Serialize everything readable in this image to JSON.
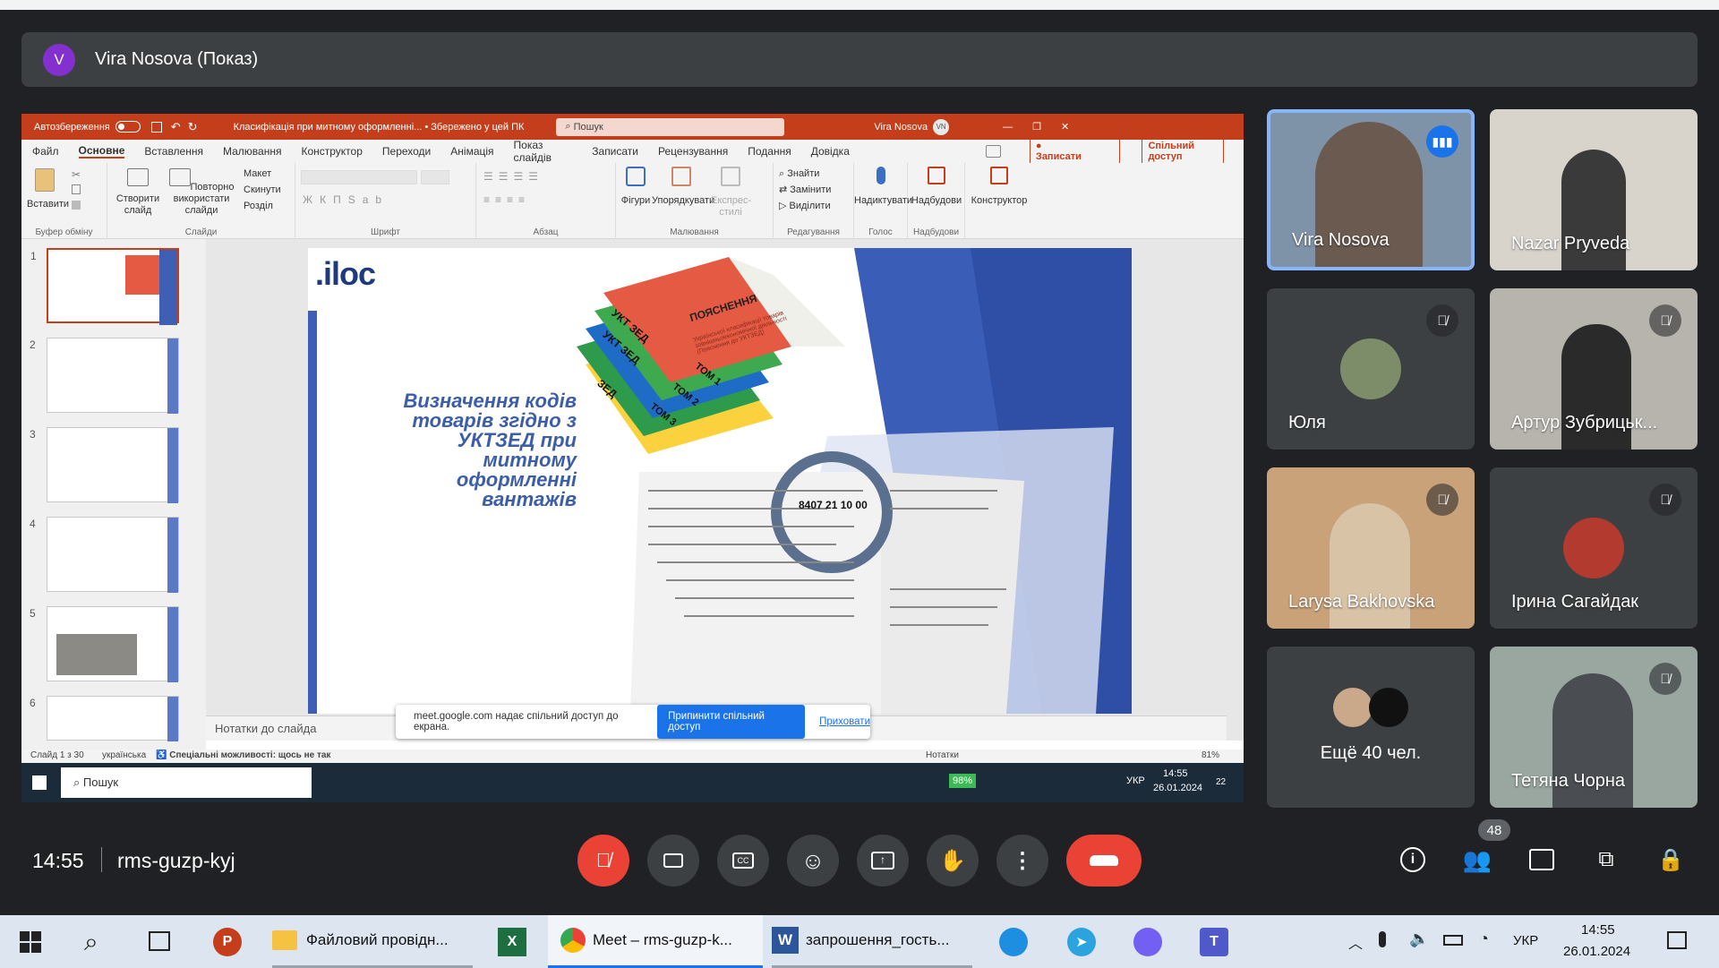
{
  "presenter": {
    "initial": "V",
    "name": "Vira Nosova (Показ)"
  },
  "ppt": {
    "autosave": "Автозбереження",
    "doc_title": "Класифікація при митному оформленні... • Збережено у цей ПК",
    "search_placeholder": "Пошук",
    "user": "Vira Nosova",
    "user_initials": "VN",
    "menu": [
      "Файл",
      "Основне",
      "Вставлення",
      "Малювання",
      "Конструктор",
      "Переходи",
      "Анімація",
      "Показ слайдів",
      "Записати",
      "Рецензування",
      "Подання",
      "Довідка"
    ],
    "record_btn": "Записати",
    "share_btn": "Спільний доступ",
    "ribbon": {
      "paste": "Вставити",
      "clipboard": "Буфер обміну",
      "new_slide": "Створити слайд",
      "reuse": "Повторно використати слайди",
      "layout": "Макет",
      "reset": "Скинути",
      "section": "Розділ",
      "slides": "Слайди",
      "font": "Шрифт",
      "paragraph": "Абзац",
      "shapes": "Фігури",
      "arrange": "Упорядкувати",
      "quick_styles": "Експрес-стилі",
      "drawing": "Малювання",
      "find": "Знайти",
      "replace": "Замінити",
      "select": "Виділити",
      "editing": "Редагування",
      "dictate": "Надиктувати",
      "voice": "Голос",
      "addins": "Надбудови",
      "addins_group": "Надбудови",
      "designer": "Конструктор"
    },
    "thumbnails": [
      "1",
      "2",
      "3",
      "4",
      "5",
      "6"
    ],
    "slide": {
      "logo": ".iloc",
      "title_l1": "Визначення кодів",
      "title_l2": "товарів згідно з",
      "title_l3": "УКТЗЕД при митному",
      "title_l4": "оформленні вантажів",
      "book_top": "ПОЯСНЕННЯ",
      "book_sub": "Української класифікації товарів зовнішньоекономічної діяльності (Пояснення до УКТЗЕД)",
      "spine1": "УКТ ЗЕД",
      "tom1": "ТОМ 1",
      "spine2": "УКТ ЗЕД",
      "tom2": "ТОМ 2",
      "spine3": "ЗЕД",
      "tom3": "ТОМ 3",
      "code": "8407 21 10 00"
    },
    "notes": "Нотатки до слайда",
    "status": {
      "slide": "Слайд 1 з 30",
      "lang": "українська",
      "access": "Спеціальні можливості: щось не так",
      "notes_btn": "Нотатки",
      "zoom": "81%"
    },
    "toast": {
      "text": "meet.google.com надає спільний доступ до екрана.",
      "stop": "Припинити спільний доступ",
      "hide": "Приховати"
    },
    "inner_taskbar": {
      "search": "Пошук",
      "battery": "98%",
      "lang": "УКР",
      "time": "14:55",
      "date": "26.01.2024",
      "notif": "22"
    }
  },
  "tiles": [
    {
      "name": "Vira Nosova",
      "speaking": true
    },
    {
      "name": "Nazar Pryveda"
    },
    {
      "name": "Юля"
    },
    {
      "name": "Артур Зубрицьк..."
    },
    {
      "name": "Larysa Bakhovska"
    },
    {
      "name": "Ірина Сагайдак"
    },
    {
      "name": "Ещё 40 чел."
    },
    {
      "name": "Тетяна Чорна"
    }
  ],
  "meet": {
    "time": "14:55",
    "code": "rms-guzp-kyj",
    "participants_count": "48"
  },
  "taskbar": {
    "explorer": "Файловий провідн...",
    "meet": "Meet – rms-guzp-k...",
    "word": "запрошення_гость...",
    "lang": "УКР",
    "time": "14:55",
    "date": "26.01.2024"
  },
  "colors": {
    "accent": "#1a73e8",
    "ppt_red": "#c43e1c",
    "end_call": "#ea4335",
    "mute": "#ea4335",
    "tile_bg": "#3c4043",
    "bg": "#202124"
  }
}
